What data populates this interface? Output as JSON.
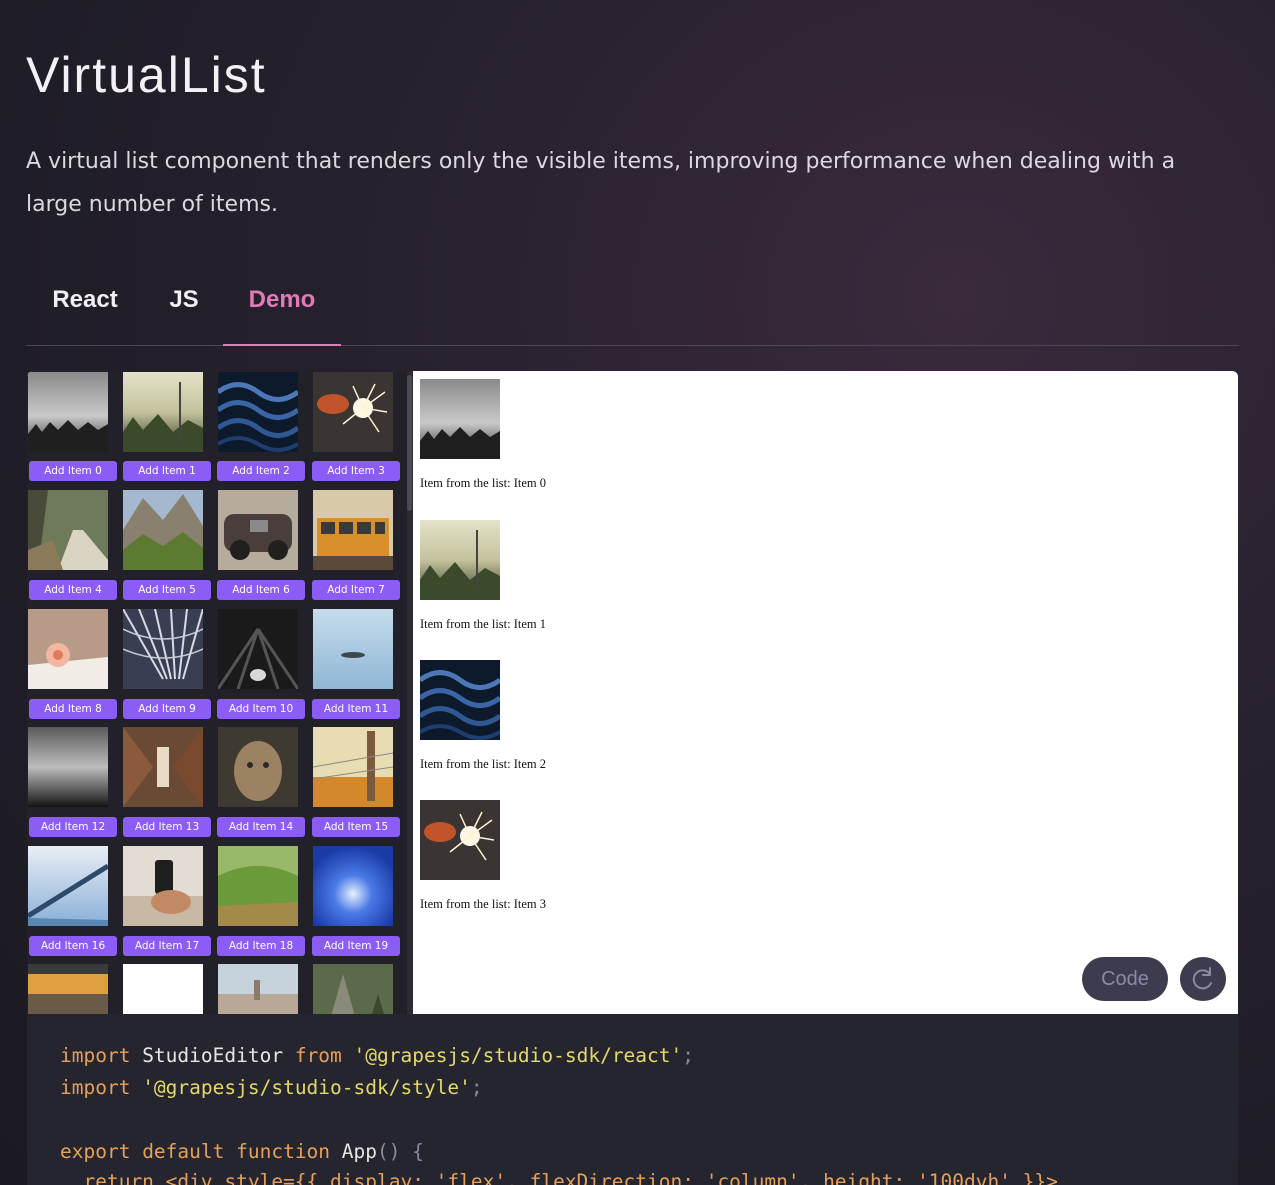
{
  "page": {
    "title": "VirtualList",
    "description": "A virtual list component that renders only the visible items, improving performance when dealing with a large number of items."
  },
  "tabs": [
    {
      "label": "React",
      "active": false
    },
    {
      "label": "JS",
      "active": false
    },
    {
      "label": "Demo",
      "active": true
    }
  ],
  "colors": {
    "accent_tab": "#e07ab8",
    "add_button": "#8b5cf6",
    "control_button": "#3d3b4e"
  },
  "gallery": {
    "buttons": [
      "Add Item 0",
      "Add Item 1",
      "Add Item 2",
      "Add Item 3",
      "Add Item 4",
      "Add Item 5",
      "Add Item 6",
      "Add Item 7",
      "Add Item 8",
      "Add Item 9",
      "Add Item 10",
      "Add Item 11",
      "Add Item 12",
      "Add Item 13",
      "Add Item 14",
      "Add Item 15",
      "Add Item 16",
      "Add Item 17",
      "Add Item 18",
      "Add Item 19"
    ]
  },
  "list": {
    "items": [
      "Item from the list: Item 0",
      "Item from the list: Item 1",
      "Item from the list: Item 2",
      "Item from the list: Item 3"
    ]
  },
  "controls": {
    "code_label": "Code",
    "refresh_icon": "refresh-icon"
  },
  "code": {
    "line1": {
      "kw1": "import",
      "name": " StudioEditor ",
      "kw2": "from",
      "str": " '@grapesjs/studio-sdk/react'",
      "end": ";"
    },
    "line2": {
      "kw1": "import",
      "str": " '@grapesjs/studio-sdk/style'",
      "end": ";"
    },
    "line4": {
      "kw1": "export",
      "kw2": " default",
      "kw3": " function",
      "name": " App",
      "paren": "()",
      "brace": " {"
    },
    "line5": {
      "text": "  return <div style={{ display: 'flex', flexDirection: 'column', height: '100dvh' }}>"
    }
  }
}
